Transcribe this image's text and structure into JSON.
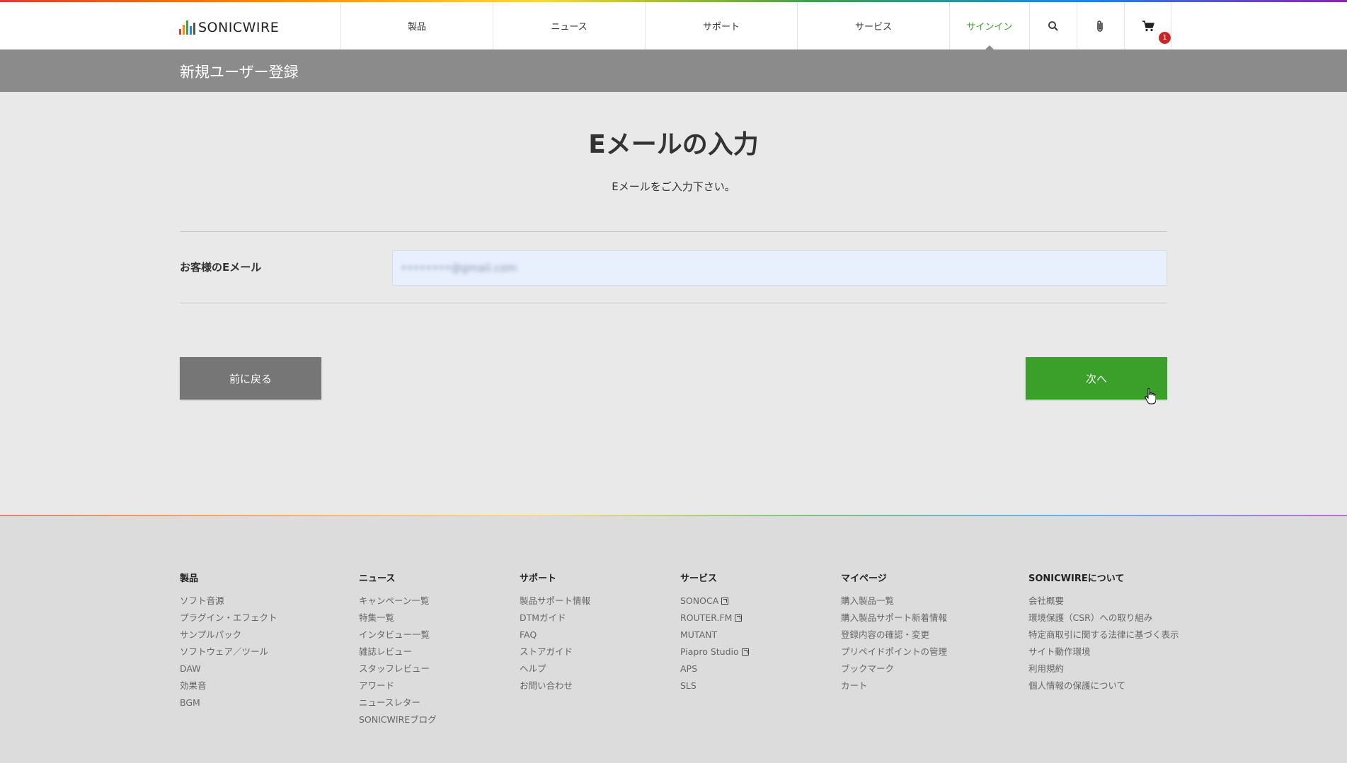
{
  "brand": {
    "name": "SONICWIRE",
    "bar_colors": [
      "#e53935",
      "#fb8c00",
      "#43a047",
      "#1e88e5",
      "#555555"
    ]
  },
  "nav": {
    "products": "製品",
    "news": "ニュース",
    "support": "サポート",
    "services": "サービス",
    "signin": "サインイン",
    "cart_count": "1"
  },
  "page_title": "新規ユーザー登録",
  "main": {
    "heading": "Eメールの入力",
    "subtitle": "Eメールをご入力下さい。",
    "email_label": "お客様のEメール",
    "email_value": "••••••••@gmail.com",
    "back_label": "前に戻る",
    "next_label": "次へ"
  },
  "colors": {
    "accent": "#3aa02a",
    "badge": "#c62828",
    "page_bar": "#8b8b8b"
  },
  "footer": {
    "columns": [
      {
        "title": "製品",
        "items": [
          {
            "label": "ソフト音源"
          },
          {
            "label": "プラグイン・エフェクト"
          },
          {
            "label": "サンプルパック"
          },
          {
            "label": "ソフトウェア／ツール"
          },
          {
            "label": "DAW"
          },
          {
            "label": "効果音"
          },
          {
            "label": "BGM"
          }
        ]
      },
      {
        "title": "ニュース",
        "items": [
          {
            "label": "キャンペーン一覧"
          },
          {
            "label": "特集一覧"
          },
          {
            "label": "インタビュー一覧"
          },
          {
            "label": "雑誌レビュー"
          },
          {
            "label": "スタッフレビュー"
          },
          {
            "label": "アワード"
          },
          {
            "label": "ニュースレター"
          },
          {
            "label": "SONICWIREブログ"
          }
        ]
      },
      {
        "title": "サポート",
        "items": [
          {
            "label": "製品サポート情報"
          },
          {
            "label": "DTMガイド"
          },
          {
            "label": "FAQ"
          },
          {
            "label": "ストアガイド"
          },
          {
            "label": "ヘルプ"
          },
          {
            "label": "お問い合わせ"
          }
        ]
      },
      {
        "title": "サービス",
        "items": [
          {
            "label": "SONOCA",
            "external": true
          },
          {
            "label": "ROUTER.FM",
            "external": true
          },
          {
            "label": "MUTANT"
          },
          {
            "label": "Piapro Studio",
            "external": true
          },
          {
            "label": "APS"
          },
          {
            "label": "SLS"
          }
        ]
      },
      {
        "title": "マイページ",
        "items": [
          {
            "label": "購入製品一覧"
          },
          {
            "label": "購入製品サポート新着情報"
          },
          {
            "label": "登録内容の確認・変更"
          },
          {
            "label": "プリペイドポイントの管理"
          },
          {
            "label": "ブックマーク"
          },
          {
            "label": "カート"
          }
        ]
      },
      {
        "title": "SONICWIREについて",
        "items": [
          {
            "label": "会社概要"
          },
          {
            "label": "環境保護（CSR）への取り組み"
          },
          {
            "label": "特定商取引に関する法律に基づく表示"
          },
          {
            "label": "サイト動作環境"
          },
          {
            "label": "利用規約"
          },
          {
            "label": "個人情報の保護について"
          }
        ]
      }
    ]
  }
}
